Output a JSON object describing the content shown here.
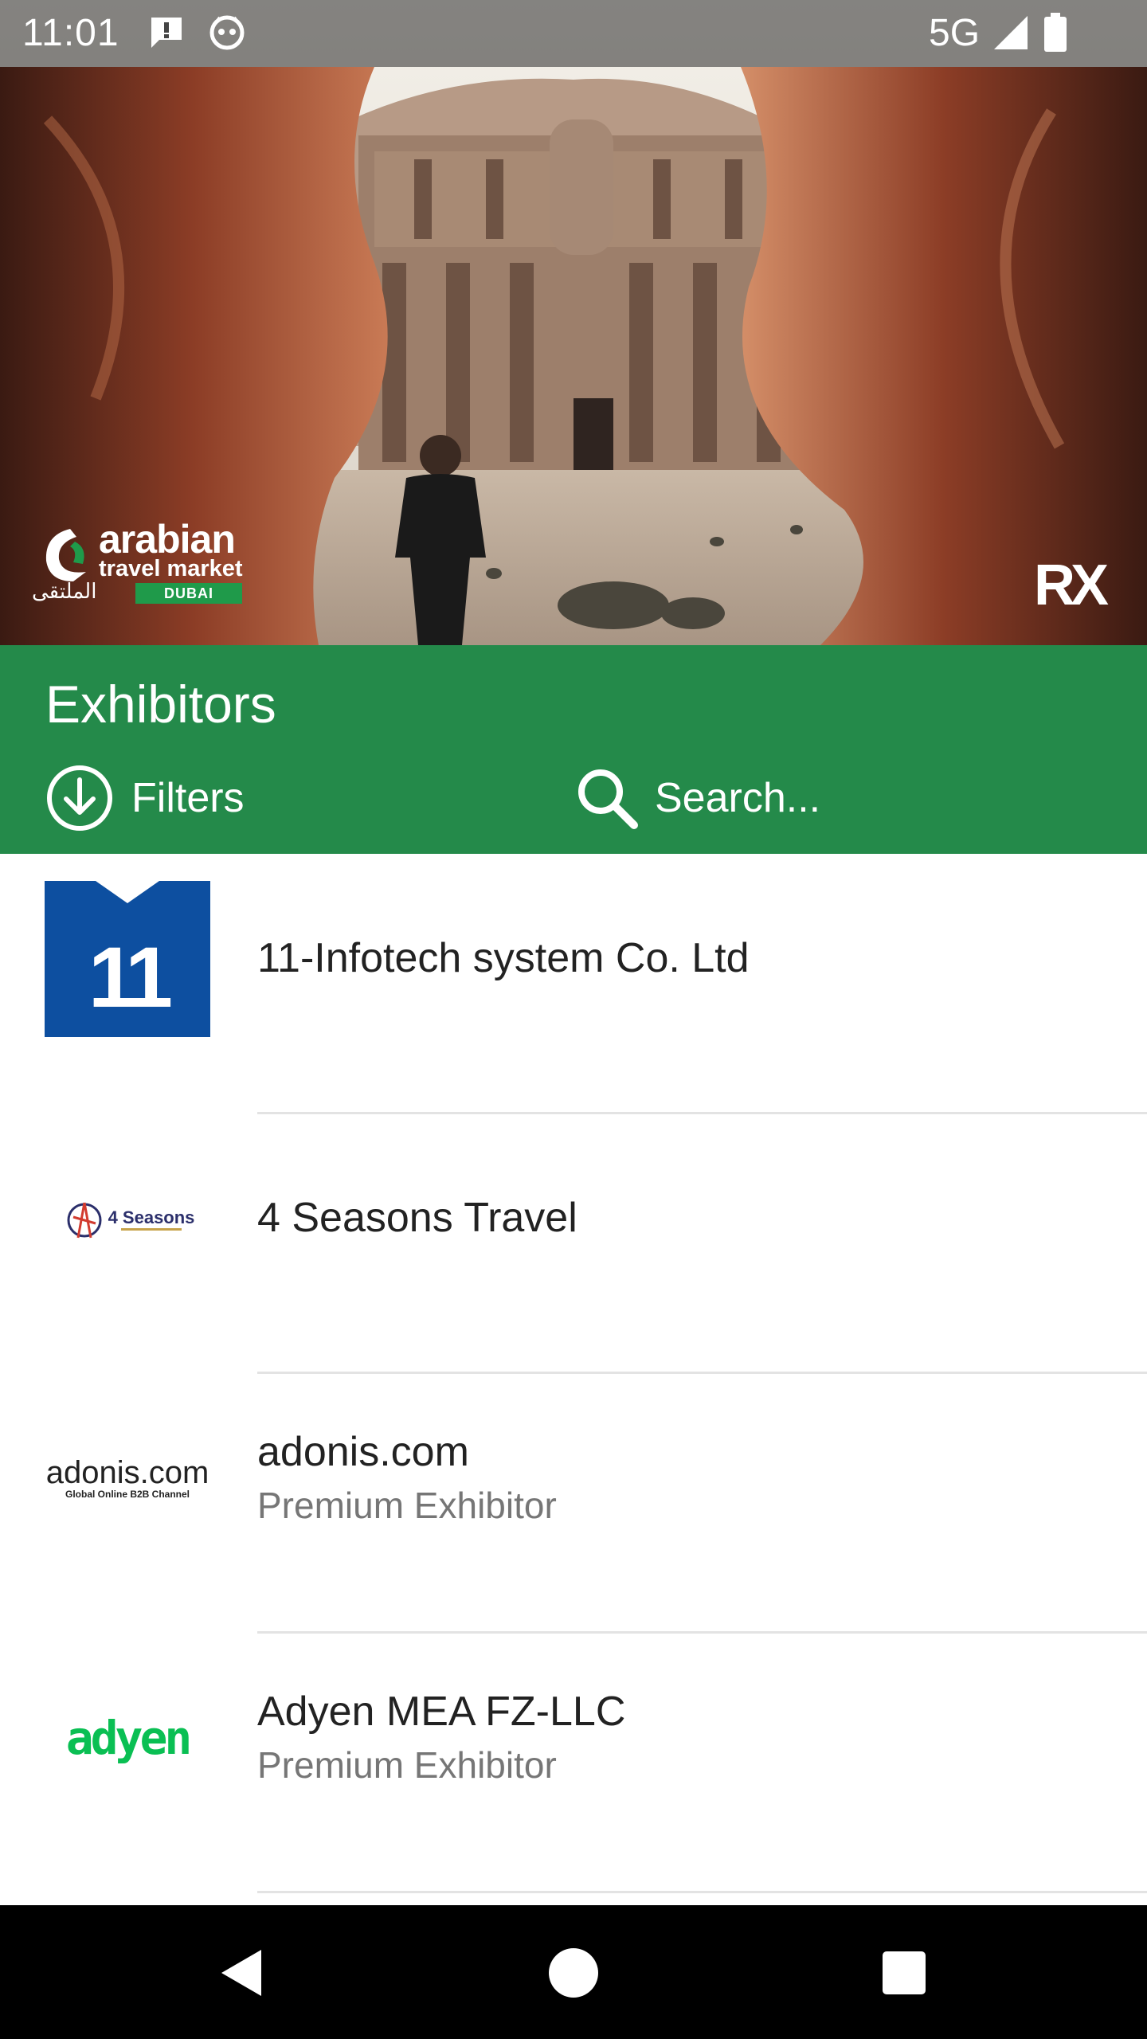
{
  "status_bar": {
    "time": "11:01",
    "network": "5G",
    "icons": [
      "alert-notification-icon",
      "assistant-face-icon",
      "signal-icon",
      "battery-icon"
    ]
  },
  "banner": {
    "event_logo": {
      "line1": "arabian",
      "line2": "travel market",
      "badge": "DUBAI",
      "arabic": "الملتقى"
    },
    "organizer_logo": "RX"
  },
  "header": {
    "title": "Exhibitors",
    "filters_label": "Filters",
    "search_placeholder": "Search..."
  },
  "exhibitors": [
    {
      "name": "11-Infotech system Co. Ltd",
      "subtitle": "",
      "logo_text": "11"
    },
    {
      "name": "4 Seasons Travel",
      "subtitle": "",
      "logo_text": "4 Seasons"
    },
    {
      "name": "adonis.com",
      "subtitle": "Premium Exhibitor",
      "logo_text": "adonis.com",
      "logo_tagline": "Global Online B2B Channel"
    },
    {
      "name": "Adyen MEA FZ-LLC",
      "subtitle": "Premium Exhibitor",
      "logo_text": "adyen"
    }
  ],
  "colors": {
    "header_green": "#248a4a",
    "adyen_green": "#0abf53",
    "infotech_blue": "#0d4fa0",
    "divider": "#e3e3e3",
    "subtitle_gray": "#767676"
  }
}
